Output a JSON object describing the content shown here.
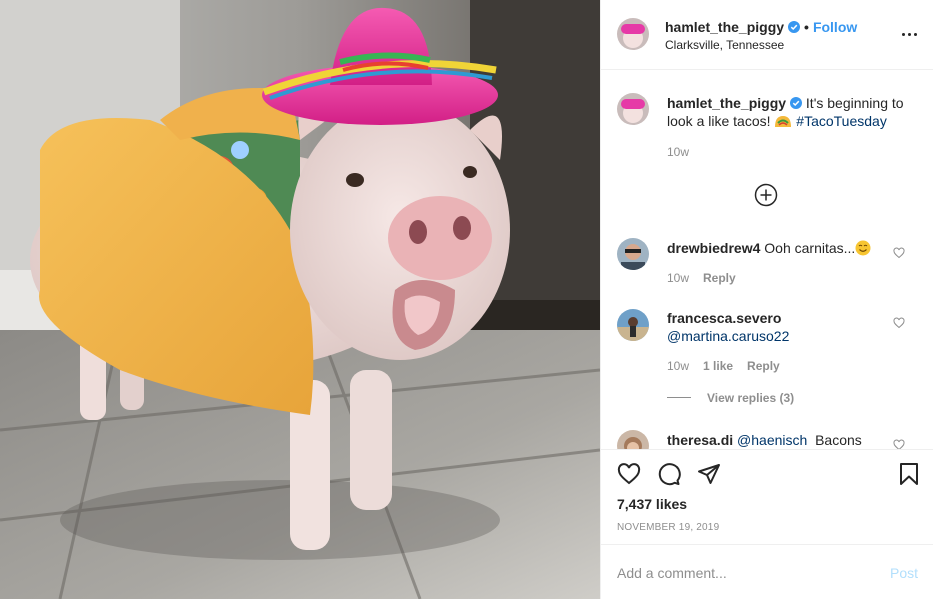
{
  "post": {
    "author": {
      "username": "hamlet_the_piggy",
      "verified": true,
      "follow_label": "Follow",
      "location": "Clarksville, Tennessee"
    },
    "caption": {
      "username": "hamlet_the_piggy",
      "text": "It's beginning to look a like tacos!",
      "emoji": "taco",
      "hashtag": "#TacoTuesday",
      "time": "10w"
    },
    "comments": [
      {
        "username": "drewbiedrew4",
        "text": "Ooh carnitas...",
        "emoji": "smiling-face",
        "time": "10w",
        "reply_label": "Reply"
      },
      {
        "username": "francesca.severo",
        "mention": "@martina.caruso22",
        "time": "10w",
        "likes": "1 like",
        "reply_label": "Reply",
        "view_replies": "View replies (3)"
      },
      {
        "username": "theresa.di",
        "mention": "@haenisch",
        "text": "Bacons"
      }
    ],
    "likes": "7,437 likes",
    "date": "NOVEMBER 19, 2019",
    "comment_input": {
      "placeholder": "Add a comment...",
      "post_label": "Post"
    }
  },
  "icons": {
    "verified": "verified-badge-icon",
    "more": "more-options-icon",
    "load_more": "plus-circle-icon",
    "like": "heart-icon",
    "comment": "comment-icon",
    "share": "share-icon",
    "save": "bookmark-icon"
  },
  "colors": {
    "link_blue": "#3897f0",
    "hashtag": "#003569",
    "muted": "#8e8e8e",
    "post_disabled": "#b2dffc"
  }
}
